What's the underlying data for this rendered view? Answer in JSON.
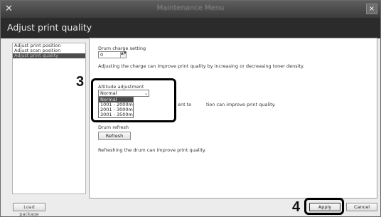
{
  "window": {
    "title": "Maintenance Menu",
    "app_icon": "tools-icon",
    "close_glyph": "×"
  },
  "header": {
    "title": "Adjust print quality"
  },
  "nav": {
    "items": [
      {
        "label": "Adjust print position",
        "selected": false
      },
      {
        "label": "Adjust scan position",
        "selected": false
      },
      {
        "label": "Adjust print quality",
        "selected": true
      }
    ]
  },
  "drum_charge": {
    "label": "Drum charge setting",
    "value": "0",
    "spin_glyph": "▲▼",
    "description": "Adjusting the charge can improve print quality by increasing or decreasing toner density."
  },
  "altitude": {
    "label": "Altitude adjustment",
    "selected": "Normal",
    "arrow_glyph": "⌄",
    "options": [
      "Normal",
      "1001 - 2000m",
      "2001 - 3000m",
      "3001 - 3500m"
    ],
    "description_visible": "ent to",
    "description_visible_2": "tion can improve print quality."
  },
  "drum_refresh": {
    "label": "Drum refresh",
    "button": "Refresh",
    "description": "Refreshing the drum can improve print quality."
  },
  "footer": {
    "load_package": "Load package",
    "apply": "Apply",
    "cancel": "Cancel"
  },
  "callouts": {
    "altitude": "3",
    "apply": "4"
  }
}
